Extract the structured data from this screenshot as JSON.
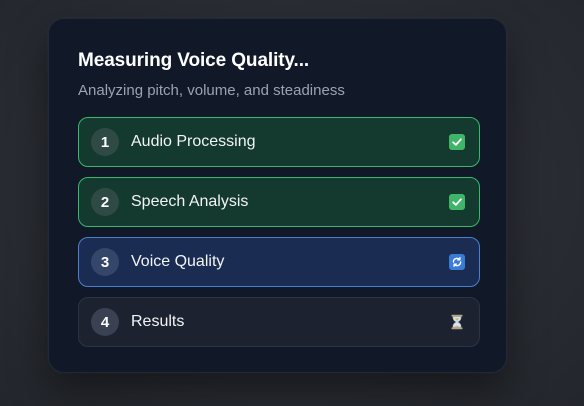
{
  "dialog": {
    "title": "Measuring Voice Quality...",
    "subtitle": "Analyzing pitch, volume, and steadiness"
  },
  "steps": [
    {
      "number": "1",
      "label": "Audio Processing",
      "status": "done",
      "icon": "check-box-icon"
    },
    {
      "number": "2",
      "label": "Speech Analysis",
      "status": "done",
      "icon": "check-box-icon"
    },
    {
      "number": "3",
      "label": "Voice Quality",
      "status": "in-progress",
      "icon": "sync-icon"
    },
    {
      "number": "4",
      "label": "Results",
      "status": "pending",
      "icon": "hourglass-icon"
    }
  ],
  "colors": {
    "done_border": "#35b96a",
    "done_bg": "#14392f",
    "active_border": "#4a7fd1",
    "active_bg": "#1b2c52",
    "pending_bg": "#1c2230",
    "card_bg": "#111827"
  }
}
